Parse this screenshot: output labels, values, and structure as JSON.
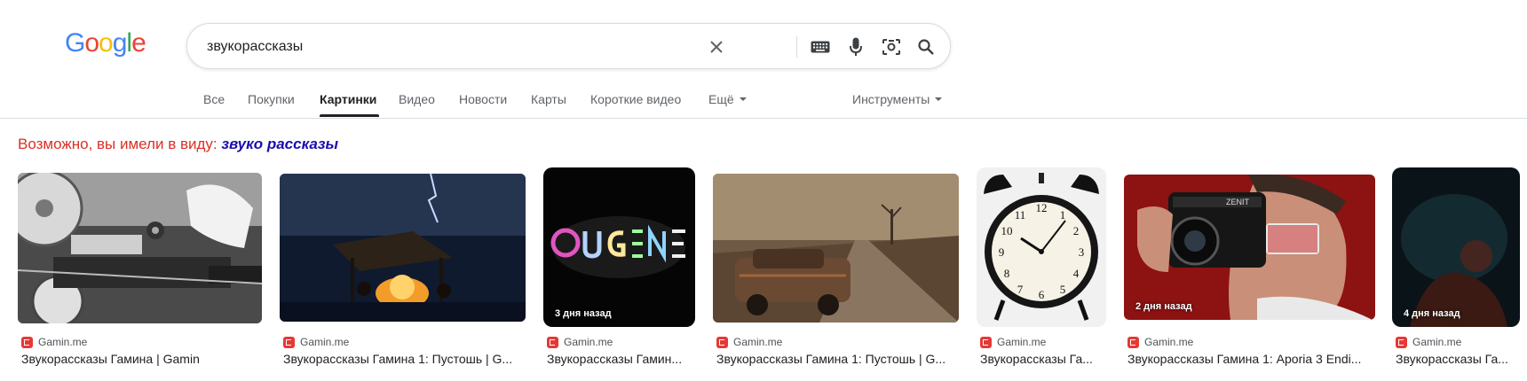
{
  "logo": {
    "letters": [
      "G",
      "o",
      "o",
      "g",
      "l",
      "e"
    ]
  },
  "search": {
    "query": "звукорассказы"
  },
  "icons": {
    "clear": "close-icon",
    "keyboard": "keyboard-icon",
    "voice": "microphone-icon",
    "lens": "camera-lens-icon",
    "search": "search-icon"
  },
  "tabs": [
    {
      "label": "Все"
    },
    {
      "label": "Покупки"
    },
    {
      "label": "Картинки"
    },
    {
      "label": "Видео"
    },
    {
      "label": "Новости"
    },
    {
      "label": "Карты"
    },
    {
      "label": "Короткие видео"
    },
    {
      "label": "Ещё"
    }
  ],
  "tools": {
    "label": "Инструменты"
  },
  "suggestion": {
    "prefix": "Возможно, вы имели в виду:",
    "link": "звуко рассказы"
  },
  "colors": {
    "logo": [
      "#4285f4",
      "#ea4335",
      "#fbbc05",
      "#4285f4",
      "#34a853",
      "#ea4335"
    ],
    "suggestion_prefix": "#d93025",
    "suggestion_link": "#1a0dab"
  },
  "results": [
    {
      "source": "Gamin.me",
      "title": "Звукорассказы Гамина | Gamin",
      "badge": "",
      "image": "reel-to-reel tape recorder"
    },
    {
      "source": "Gamin.me",
      "title": "Звукорассказы Гамина 1: Пустошь | G...",
      "badge": "",
      "image": "campfire under stormy night sky"
    },
    {
      "source": "Gamin.me",
      "title": "Звукорассказы Гамин...",
      "badge": "3 дня назад",
      "image": "glowing EUGENE letters"
    },
    {
      "source": "Gamin.me",
      "title": "Звукорассказы Гамина 1: Пустошь | G...",
      "badge": "",
      "image": "rusty car on wasteland road"
    },
    {
      "source": "Gamin.me",
      "title": "Звукорассказы Га...",
      "badge": "",
      "image": "alarm clock"
    },
    {
      "source": "Gamin.me",
      "title": "Звукорассказы Гамина 1: Aporia 3 Endi...",
      "badge": "2 дня назад",
      "image": "man with Zenit camera"
    },
    {
      "source": "Gamin.me",
      "title": "Звукорассказы Га...",
      "badge": "4 дня назад",
      "image": "dark cinematic scene"
    }
  ]
}
